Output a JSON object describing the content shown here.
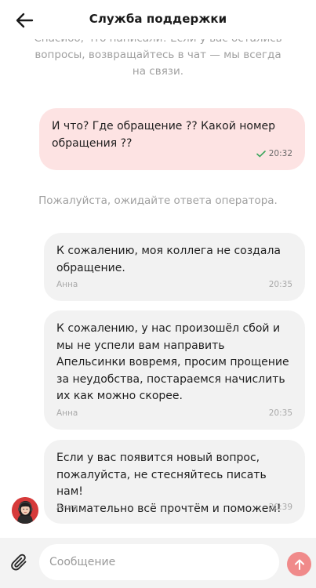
{
  "header": {
    "title": "Служба поддержки",
    "back_icon": "arrow-left-icon"
  },
  "chat": {
    "system_top": {
      "line1": "Спасибо, что написали! Если у вас остались",
      "line2": "вопросы, возвращайтесь в чат — мы всегда",
      "line3": "на связи."
    },
    "outgoing": {
      "text": "И что? Где обращение ?? Какой номер\nобращения ??",
      "time": "20:32",
      "status_icon": "check-icon",
      "status": "delivered"
    },
    "system_mid": "Пожалуйста, ожидайте ответа оператора.",
    "incoming": [
      {
        "text": "К сожалению, моя коллега не создала\nобращение.",
        "author": "Анна",
        "time": "20:35"
      },
      {
        "text": "К сожалению, у нас произошёл сбой и\nмы не успели вам направить\nАпельсинки вовремя, просим прощение\nза неудобства, постараемся начислить\nих как можно скорее.",
        "author": "Анна",
        "time": "20:35"
      },
      {
        "text": "Если у вас появится новый вопрос,\nпожалуйста, не стесняйтесь писать нам!\nВнимательно всё прочтём и поможем!",
        "author": "Анна",
        "time": "20:39"
      }
    ],
    "operator_avatar": "operator-avatar"
  },
  "input": {
    "placeholder": "Сообщение",
    "value": "",
    "attach_icon": "paperclip-icon",
    "send_icon": "arrow-up-icon"
  },
  "colors": {
    "outgoing_bubble": "#fde3e3",
    "incoming_bubble": "#f2f2f2",
    "send_button": "#f08a8a",
    "check": "#3aa55c",
    "system_text": "#a0a0a0"
  }
}
